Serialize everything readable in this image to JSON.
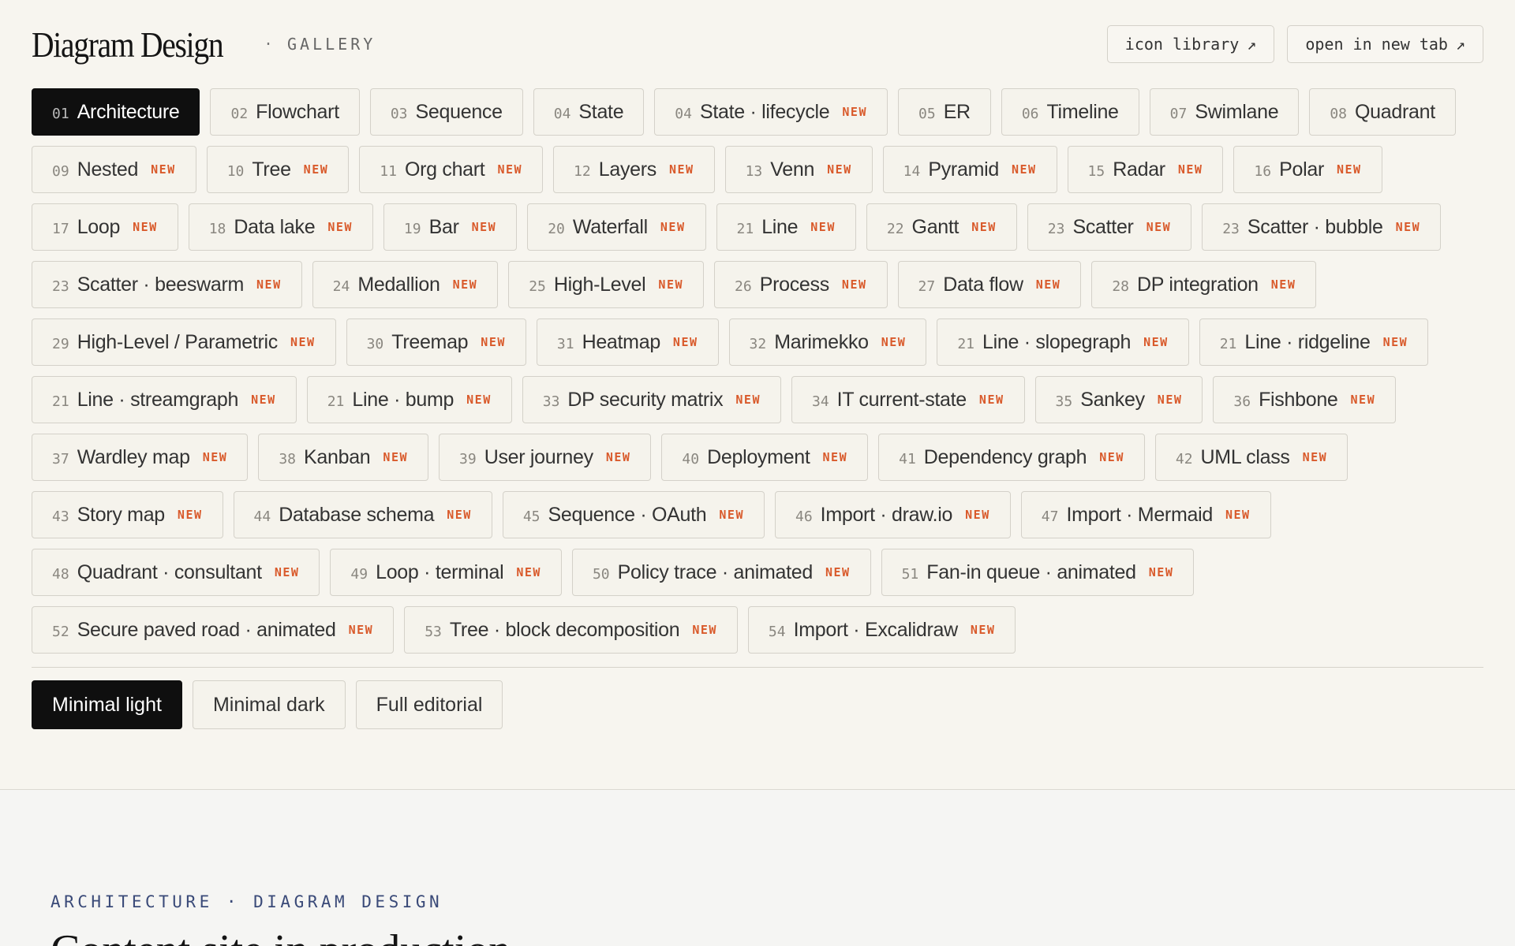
{
  "brand": {
    "title": "Diagram Design",
    "separator": "·",
    "subtitle": "GALLERY"
  },
  "header_links": [
    {
      "label": "icon library",
      "icon": "↗"
    },
    {
      "label": "open in new tab",
      "icon": "↗"
    }
  ],
  "new_badge": "NEW",
  "tabs": [
    {
      "num": "01",
      "label": "Architecture",
      "new": false,
      "active": true
    },
    {
      "num": "02",
      "label": "Flowchart",
      "new": false
    },
    {
      "num": "03",
      "label": "Sequence",
      "new": false
    },
    {
      "num": "04",
      "label": "State",
      "new": false
    },
    {
      "num": "04",
      "label": "State · lifecycle",
      "new": true
    },
    {
      "num": "05",
      "label": "ER",
      "new": false
    },
    {
      "num": "06",
      "label": "Timeline",
      "new": false
    },
    {
      "num": "07",
      "label": "Swimlane",
      "new": false
    },
    {
      "num": "08",
      "label": "Quadrant",
      "new": false
    },
    {
      "num": "09",
      "label": "Nested",
      "new": true
    },
    {
      "num": "10",
      "label": "Tree",
      "new": true
    },
    {
      "num": "11",
      "label": "Org chart",
      "new": true
    },
    {
      "num": "12",
      "label": "Layers",
      "new": true
    },
    {
      "num": "13",
      "label": "Venn",
      "new": true
    },
    {
      "num": "14",
      "label": "Pyramid",
      "new": true
    },
    {
      "num": "15",
      "label": "Radar",
      "new": true
    },
    {
      "num": "16",
      "label": "Polar",
      "new": true
    },
    {
      "num": "17",
      "label": "Loop",
      "new": true
    },
    {
      "num": "18",
      "label": "Data lake",
      "new": true
    },
    {
      "num": "19",
      "label": "Bar",
      "new": true
    },
    {
      "num": "20",
      "label": "Waterfall",
      "new": true
    },
    {
      "num": "21",
      "label": "Line",
      "new": true
    },
    {
      "num": "22",
      "label": "Gantt",
      "new": true
    },
    {
      "num": "23",
      "label": "Scatter",
      "new": true
    },
    {
      "num": "23",
      "label": "Scatter · bubble",
      "new": true
    },
    {
      "num": "23",
      "label": "Scatter · beeswarm",
      "new": true
    },
    {
      "num": "24",
      "label": "Medallion",
      "new": true
    },
    {
      "num": "25",
      "label": "High-Level",
      "new": true
    },
    {
      "num": "26",
      "label": "Process",
      "new": true
    },
    {
      "num": "27",
      "label": "Data flow",
      "new": true
    },
    {
      "num": "28",
      "label": "DP integration",
      "new": true
    },
    {
      "num": "29",
      "label": "High-Level / Parametric",
      "new": true
    },
    {
      "num": "30",
      "label": "Treemap",
      "new": true
    },
    {
      "num": "31",
      "label": "Heatmap",
      "new": true
    },
    {
      "num": "32",
      "label": "Marimekko",
      "new": true
    },
    {
      "num": "21",
      "label": "Line · slopegraph",
      "new": true
    },
    {
      "num": "21",
      "label": "Line · ridgeline",
      "new": true
    },
    {
      "num": "21",
      "label": "Line · streamgraph",
      "new": true
    },
    {
      "num": "21",
      "label": "Line · bump",
      "new": true
    },
    {
      "num": "33",
      "label": "DP security matrix",
      "new": true
    },
    {
      "num": "34",
      "label": "IT current-state",
      "new": true
    },
    {
      "num": "35",
      "label": "Sankey",
      "new": true
    },
    {
      "num": "36",
      "label": "Fishbone",
      "new": true
    },
    {
      "num": "37",
      "label": "Wardley map",
      "new": true
    },
    {
      "num": "38",
      "label": "Kanban",
      "new": true
    },
    {
      "num": "39",
      "label": "User journey",
      "new": true
    },
    {
      "num": "40",
      "label": "Deployment",
      "new": true
    },
    {
      "num": "41",
      "label": "Dependency graph",
      "new": true
    },
    {
      "num": "42",
      "label": "UML class",
      "new": true
    },
    {
      "num": "43",
      "label": "Story map",
      "new": true
    },
    {
      "num": "44",
      "label": "Database schema",
      "new": true
    },
    {
      "num": "45",
      "label": "Sequence · OAuth",
      "new": true
    },
    {
      "num": "46",
      "label": "Import · draw.io",
      "new": true
    },
    {
      "num": "47",
      "label": "Import · Mermaid",
      "new": true
    },
    {
      "num": "48",
      "label": "Quadrant · consultant",
      "new": true
    },
    {
      "num": "49",
      "label": "Loop · terminal",
      "new": true
    },
    {
      "num": "50",
      "label": "Policy trace · animated",
      "new": true
    },
    {
      "num": "51",
      "label": "Fan-in queue · animated",
      "new": true
    },
    {
      "num": "52",
      "label": "Secure paved road · animated",
      "new": true
    },
    {
      "num": "53",
      "label": "Tree · block decomposition",
      "new": true
    },
    {
      "num": "54",
      "label": "Import · Excalidraw",
      "new": true
    }
  ],
  "themes": [
    {
      "label": "Minimal light",
      "active": true
    },
    {
      "label": "Minimal dark",
      "active": false
    },
    {
      "label": "Full editorial",
      "active": false
    }
  ],
  "content": {
    "eyebrow": "ARCHITECTURE · DIAGRAM DESIGN",
    "headline": "Content site in production"
  },
  "colors": {
    "accent_new": "#d95a2b",
    "active_bg": "#0f0f0f",
    "page_bg": "#f7f5ef",
    "eyebrow": "#3a4a78"
  }
}
